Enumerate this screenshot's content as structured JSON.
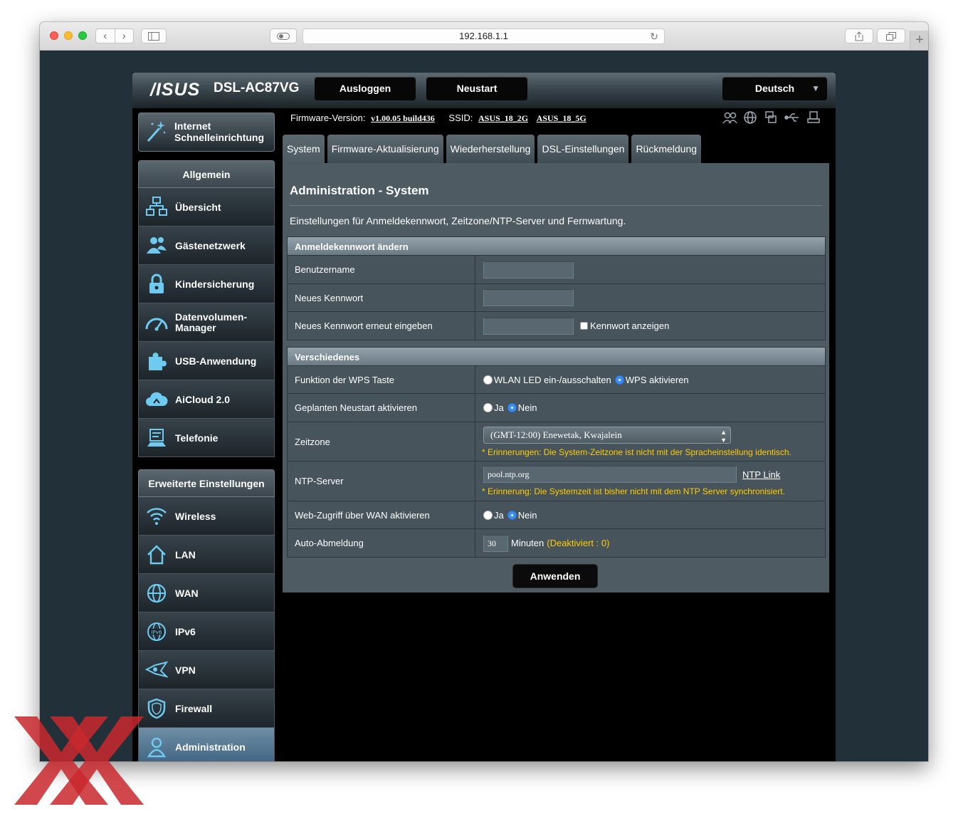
{
  "browser": {
    "url": "192.168.1.1",
    "nav_back": "‹",
    "nav_forward": "›"
  },
  "header": {
    "logo": "/ISUS",
    "model": "DSL-AC87VG",
    "logout": "Ausloggen",
    "reboot": "Neustart",
    "language": "Deutsch"
  },
  "info": {
    "firmware_label": "Firmware-Version:",
    "firmware_value": "v1.00.05 build436",
    "ssid_label": "SSID:",
    "ssid_2g": "ASUS_18_2G",
    "ssid_5g": "ASUS_18_5G"
  },
  "sidebar": {
    "qis": "Internet\nSchnelleinrichtung",
    "general_head": "Allgemein",
    "general_items": [
      {
        "label": "Übersicht",
        "icon": "network-map-icon"
      },
      {
        "label": "Gästenetzwerk",
        "icon": "guest-network-icon"
      },
      {
        "label": "Kindersicherung",
        "icon": "lock-icon"
      },
      {
        "label": "Datenvolumen-\nManager",
        "icon": "gauge-icon"
      },
      {
        "label": "USB-Anwendung",
        "icon": "puzzle-icon"
      },
      {
        "label": "AiCloud 2.0",
        "icon": "cloud-icon"
      },
      {
        "label": "Telefonie",
        "icon": "phone-icon"
      }
    ],
    "advanced_head": "Erweiterte Einstellungen",
    "advanced_items": [
      {
        "label": "Wireless",
        "icon": "wifi-icon"
      },
      {
        "label": "LAN",
        "icon": "home-icon"
      },
      {
        "label": "WAN",
        "icon": "globe-icon"
      },
      {
        "label": "IPv6",
        "icon": "ipv6-icon"
      },
      {
        "label": "VPN",
        "icon": "vpn-icon"
      },
      {
        "label": "Firewall",
        "icon": "shield-icon"
      },
      {
        "label": "Administration",
        "icon": "admin-icon"
      }
    ]
  },
  "tabs": [
    {
      "label": "System",
      "active": true
    },
    {
      "label": "Firmware-Aktualisierung",
      "active": false
    },
    {
      "label": "Wiederherstellung",
      "active": false
    },
    {
      "label": "DSL-Einstellungen",
      "active": false
    },
    {
      "label": "Rückmeldung",
      "active": false
    }
  ],
  "page": {
    "title": "Administration - System",
    "description": "Einstellungen für Anmeldekennwort, Zeitzone/NTP-Server und Fernwartung."
  },
  "password_section": {
    "header": "Anmeldekennwort ändern",
    "username_label": "Benutzername",
    "new_password_label": "Neues Kennwort",
    "repeat_password_label": "Neues Kennwort erneut eingeben",
    "show_password_label": "Kennwort anzeigen"
  },
  "misc_section": {
    "header": "Verschiedenes",
    "wps_label": "Funktion der WPS Taste",
    "wps_option_led": "WLAN LED ein-/ausschalten",
    "wps_option_wps": "WPS aktivieren",
    "reboot_label": "Geplanten Neustart aktivieren",
    "yes": "Ja",
    "no": "Nein",
    "timezone_label": "Zeitzone",
    "timezone_value": "(GMT-12:00) Enewetak, Kwajalein",
    "timezone_hint": "* Erinnerungen: Die System-Zeitzone ist nicht mit der Spracheinstellung identisch.",
    "ntp_label": "NTP-Server",
    "ntp_value": "pool.ntp.org",
    "ntp_link": "NTP Link",
    "ntp_hint": "* Erinnerung: Die Systemzeit ist bisher nicht mit dem NTP Server synchronisiert.",
    "wan_access_label": "Web-Zugriff über WAN aktivieren",
    "autologout_label": "Auto-Abmeldung",
    "autologout_value": "30",
    "autologout_unit": "Minuten",
    "autologout_note": "(Deaktiviert : 0)"
  },
  "apply": "Anwenden",
  "colors": {
    "accent_blue": "#6fcaf0",
    "hint_yellow": "#ffcc00",
    "watermark_red": "#c9282d"
  }
}
